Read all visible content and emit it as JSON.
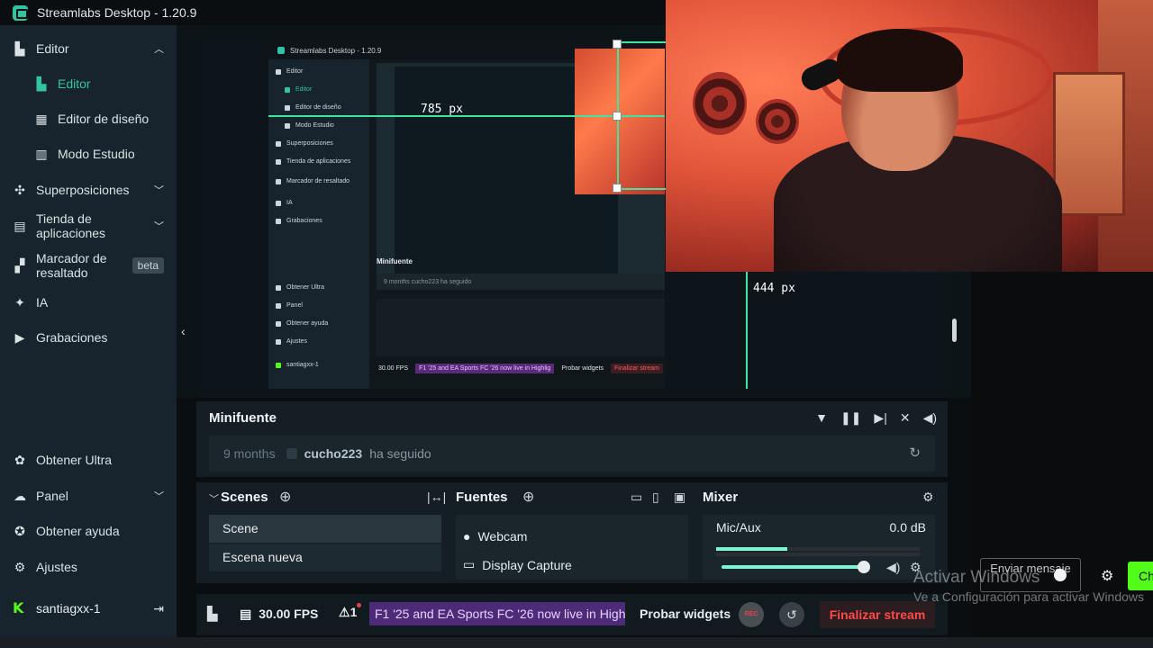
{
  "app": {
    "title": "Streamlabs Desktop - 1.20.9"
  },
  "sidebar": {
    "items": [
      {
        "label": "Editor"
      },
      {
        "label": "Editor"
      },
      {
        "label": "Editor de diseño"
      },
      {
        "label": "Modo Estudio"
      },
      {
        "label": "Superposiciones"
      },
      {
        "label": "Tienda de aplicaciones"
      },
      {
        "label": "Marcador de resaltado",
        "badge": "beta"
      },
      {
        "label": "IA"
      },
      {
        "label": "Grabaciones"
      },
      {
        "label": "Obtener Ultra"
      },
      {
        "label": "Panel"
      },
      {
        "label": "Obtener ayuda"
      },
      {
        "label": "Ajustes"
      }
    ],
    "user": {
      "name": "santiagxx-1"
    }
  },
  "editor": {
    "measure_horizontal": "785 px",
    "measure_vertical": "444 px"
  },
  "nested_preview": {
    "title": "Streamlabs Desktop - 1.20.9",
    "items": [
      "Editor",
      "Editor",
      "Editor de diseño",
      "Modo Estudio",
      "Superposiciones",
      "Tienda de aplicaciones",
      "Marcador de resaltado",
      "IA",
      "Grabaciones",
      "Obtener Ultra",
      "Panel",
      "Obtener ayuda",
      "Ajustes",
      "santiagxx-1"
    ],
    "minifuente": "Minifuente",
    "event": "9 months  cucho223  ha seguido",
    "fps": "30.00 FPS",
    "promo": "F1 '25 and EA Sports FC '26 now live in Highlig",
    "widgets": "Probar widgets",
    "end": "Finalizar stream"
  },
  "minifuente": {
    "title": "Minifuente",
    "event": {
      "time": "9 months",
      "user": "cucho223",
      "action": "ha seguido"
    }
  },
  "scenes": {
    "title": "Scenes",
    "items": [
      "Scene",
      "Escena nueva"
    ]
  },
  "sources": {
    "title": "Fuentes",
    "items": [
      "Webcam",
      "Display Capture"
    ]
  },
  "mixer": {
    "title": "Mixer",
    "channel": "Mic/Aux",
    "db": "0.0 dB",
    "meter_level": 0.35,
    "volume": 1.0
  },
  "footer": {
    "fps": "30.00 FPS",
    "alert_count": "1",
    "promo": "F1 '25 and EA Sports FC '26 now live in Highlig",
    "test_widgets": "Probar widgets",
    "rec": "REC",
    "end_stream": "Finalizar stream"
  },
  "overlay": {
    "send_message": "Enviar mensaje",
    "chat": "Ch",
    "activate_title": "Activar Windows",
    "activate_sub": "Ve a Configuración para activar Windows"
  },
  "colors": {
    "accent": "#31c3a2",
    "guide": "#3fe4a0",
    "end_stream": "#ff4a4a",
    "promo": "#4d2b78",
    "kick": "#53fc18"
  }
}
